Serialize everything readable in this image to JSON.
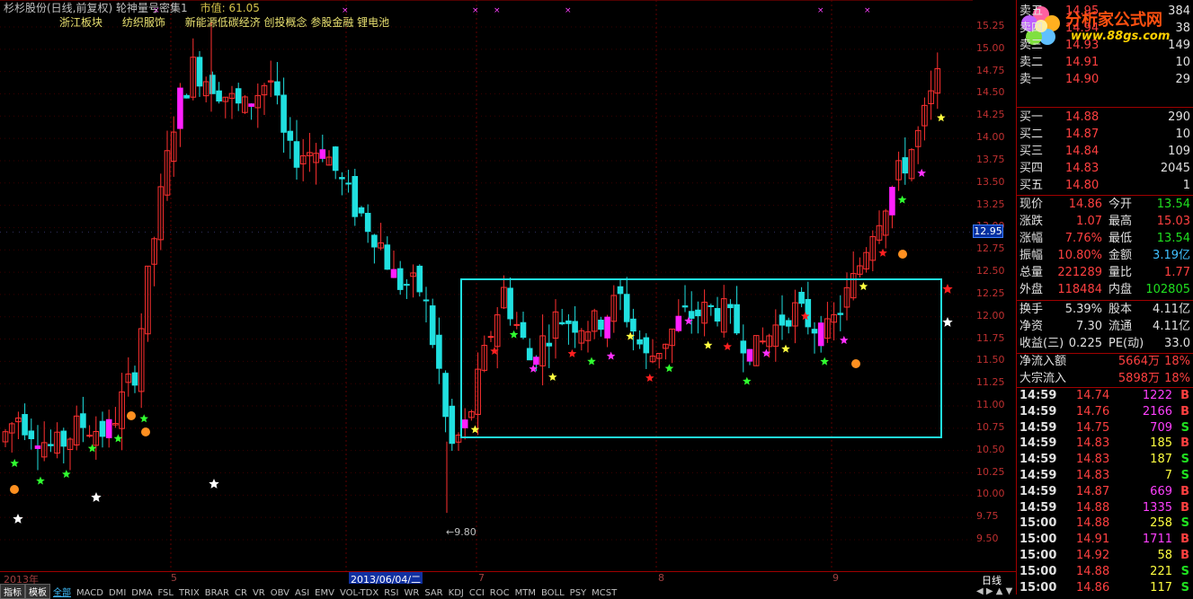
{
  "header": {
    "title": "杉杉股份(日线,前复权) 轮神量号密集1",
    "market_value": "市值: 61.05"
  },
  "concepts": [
    "浙江板块",
    "纺织服饰",
    "新能源低碳经济 创投概念 参股金融 锂电池"
  ],
  "low_marker": "←9.80",
  "date_axis": {
    "year": "2013年",
    "m5": "5",
    "selected": "2013/06/04/二",
    "m7": "7",
    "m8": "8",
    "m9": "9"
  },
  "indicator_tabs": [
    "指标",
    "模板",
    "全部",
    "MACD",
    "DMI",
    "DMA",
    "FSL",
    "TRIX",
    "BRAR",
    "CR",
    "VR",
    "OBV",
    "ASI",
    "EMV",
    "VOL-TDX",
    "RSI",
    "WR",
    "SAR",
    "KDJ",
    "CCI",
    "ROC",
    "MTM",
    "BOLL",
    "PSY",
    "MCST"
  ],
  "price_axis": {
    "ticks": [
      "15.25",
      "15.00",
      "14.75",
      "14.50",
      "14.25",
      "14.00",
      "13.75",
      "13.50",
      "13.25",
      "13.00",
      "12.75",
      "12.50",
      "12.25",
      "12.00",
      "11.75",
      "11.50",
      "11.25",
      "11.00",
      "10.75",
      "10.50",
      "10.25",
      "10.00",
      "9.75",
      "9.50"
    ],
    "current": "12.95",
    "period": "日线",
    "nav_arrows": "◀ ▶ ▲ ▼"
  },
  "logo": {
    "name": "分析家公式网",
    "url": "www.88gs.com"
  },
  "order_book": [
    {
      "label": "卖五",
      "price": "14.95",
      "vol": "384"
    },
    {
      "label": "卖四",
      "price": "14.94",
      "vol": "38"
    },
    {
      "label": "卖三",
      "price": "14.93",
      "vol": "149"
    },
    {
      "label": "卖二",
      "price": "14.91",
      "vol": "10"
    },
    {
      "label": "卖一",
      "price": "14.90",
      "vol": "29"
    },
    {
      "label": "买一",
      "price": "14.88",
      "vol": "290"
    },
    {
      "label": "买二",
      "price": "14.87",
      "vol": "10"
    },
    {
      "label": "买三",
      "price": "14.84",
      "vol": "109"
    },
    {
      "label": "买四",
      "price": "14.83",
      "vol": "2045"
    },
    {
      "label": "买五",
      "price": "14.80",
      "vol": "1"
    }
  ],
  "quote": [
    {
      "l1": "现价",
      "v1": "14.86",
      "l2": "今开",
      "v2": "13.54",
      "c2": "#20e020"
    },
    {
      "l1": "涨跌",
      "v1": "1.07",
      "l2": "最高",
      "v2": "15.03",
      "c2": "#ff4040"
    },
    {
      "l1": "涨幅",
      "v1": "7.76%",
      "l2": "最低",
      "v2": "13.54",
      "c2": "#20e020"
    },
    {
      "l1": "振幅",
      "v1": "10.80%",
      "l2": "金额",
      "v2": "3.19亿",
      "c2": "#40c0ff"
    },
    {
      "l1": "总量",
      "v1": "221289",
      "l2": "量比",
      "v2": "1.77",
      "c2": "#ff4040"
    },
    {
      "l1": "外盘",
      "v1": "118484",
      "l2": "内盘",
      "v2": "102805",
      "c2": "#20e020"
    }
  ],
  "stats": [
    {
      "l1": "换手",
      "v1": "5.39%",
      "l2": "股本",
      "v2": "4.11亿"
    },
    {
      "l1": "净资",
      "v1": "7.30",
      "l2": "流通",
      "v2": "4.11亿"
    },
    {
      "l1": "收益(三)",
      "v1": "0.225",
      "l2": "PE(动)",
      "v2": "33.0"
    }
  ],
  "flows": [
    {
      "label": "净流入额",
      "amount": "5664万",
      "pct": "18%"
    },
    {
      "label": "大宗流入",
      "amount": "5898万",
      "pct": "18%"
    }
  ],
  "trades": [
    {
      "time": "14:59",
      "price": "14.74",
      "vol": "1222",
      "side": "B"
    },
    {
      "time": "14:59",
      "price": "14.76",
      "vol": "2166",
      "side": "B"
    },
    {
      "time": "14:59",
      "price": "14.75",
      "vol": "709",
      "side": "S"
    },
    {
      "time": "14:59",
      "price": "14.83",
      "vol": "185",
      "side": "B"
    },
    {
      "time": "14:59",
      "price": "14.83",
      "vol": "187",
      "side": "S"
    },
    {
      "time": "14:59",
      "price": "14.83",
      "vol": "7",
      "side": "S"
    },
    {
      "time": "14:59",
      "price": "14.87",
      "vol": "669",
      "side": "B"
    },
    {
      "time": "14:59",
      "price": "14.88",
      "vol": "1335",
      "side": "B"
    },
    {
      "time": "15:00",
      "price": "14.88",
      "vol": "258",
      "side": "S"
    },
    {
      "time": "15:00",
      "price": "14.91",
      "vol": "1711",
      "side": "B"
    },
    {
      "time": "15:00",
      "price": "14.92",
      "vol": "58",
      "side": "B"
    },
    {
      "time": "15:00",
      "price": "14.88",
      "vol": "221",
      "side": "S"
    },
    {
      "time": "15:00",
      "price": "14.86",
      "vol": "117",
      "side": "S"
    }
  ],
  "colors": {
    "up": "#ff3030",
    "down": "#20e0e0",
    "magenta": "#ff20ff",
    "box": "#20e0e0",
    "buy": "#ff4040",
    "sell": "#20e020",
    "big_vol": "#ff40ff"
  }
}
